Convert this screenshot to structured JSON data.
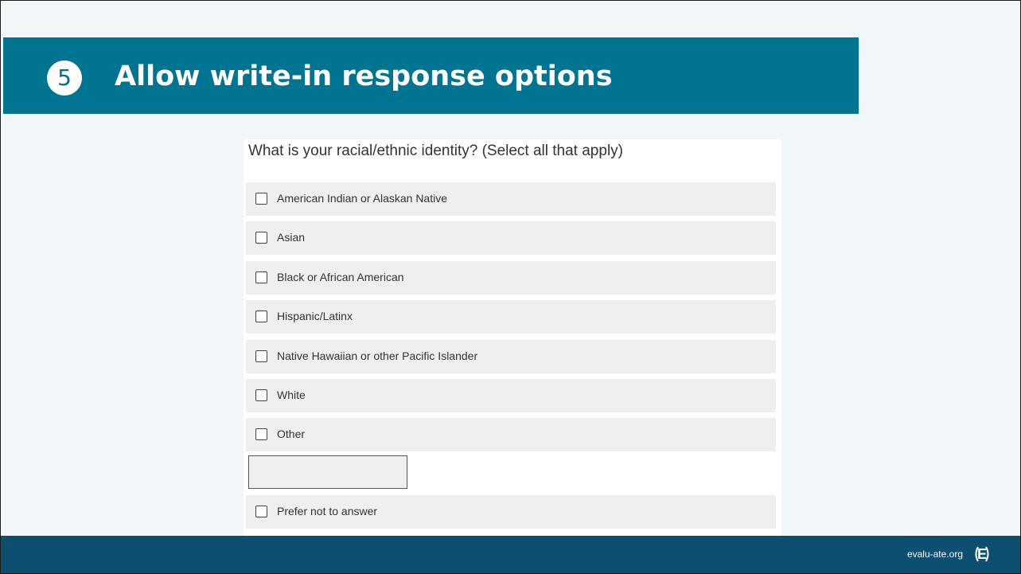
{
  "slide": {
    "number": "5",
    "title": "Allow write-in response options"
  },
  "form": {
    "question": "What is your racial/ethnic identity? (Select all that apply)",
    "options": [
      {
        "label": "American Indian or Alaskan Native",
        "checked": false
      },
      {
        "label": "Asian",
        "checked": false
      },
      {
        "label": "Black or African American",
        "checked": false
      },
      {
        "label": "Hispanic/Latinx",
        "checked": false
      },
      {
        "label": "Native Hawaiian or other Pacific Islander",
        "checked": false
      },
      {
        "label": "White",
        "checked": false
      },
      {
        "label": "Other",
        "checked": false
      }
    ],
    "write_in": {
      "value": "",
      "placeholder": ""
    },
    "last_option": {
      "label": "Prefer not to answer",
      "checked": false
    }
  },
  "footer": {
    "site": "evalu-ate.org",
    "logo_letter": "E",
    "logo_icon": "evaluate-logo-icon"
  },
  "colors": {
    "title_bar": "#007490",
    "footer": "#0d4f71",
    "background": "#f1f7f9"
  }
}
